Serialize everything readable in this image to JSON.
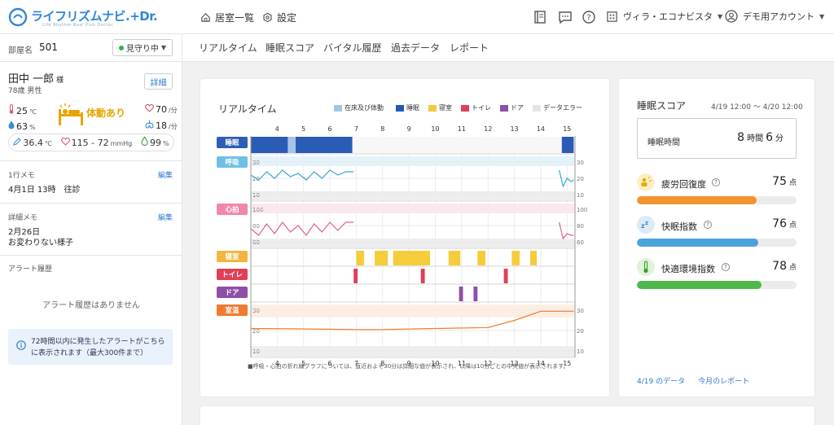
{
  "header": {
    "app_name": "ライフリズムナビ.+Dr.",
    "app_sub": "Life Rhythm Navi Plus Doctor",
    "nav_rooms": "居室一覧",
    "nav_settings": "設定",
    "facility": "ヴィラ・エコナビスタ",
    "account": "デモ用アカウント"
  },
  "sidebar": {
    "room_label": "部屋名",
    "room_no": "501",
    "watch_status": "見守り中",
    "resident_name": "田中 一郎",
    "honorific": "様",
    "age_gender": "78歳 男性",
    "detail_btn": "詳細",
    "temp_room": "25",
    "temp_unit": "℃",
    "humidity": "63",
    "humidity_unit": "%",
    "movement": "体動あり",
    "heart": "70",
    "heart_unit": "/分",
    "resp": "18",
    "resp_unit": "/分",
    "body_temp": "36.4",
    "body_temp_unit": "℃",
    "bp": "115 - 72",
    "bp_unit": "mmHg",
    "spo2": "99",
    "spo2_unit": "%",
    "memo1_label": "1行メモ",
    "memo1_edit": "編集",
    "memo1_body": "4月1日 13時　往診",
    "memo2_label": "詳細メモ",
    "memo2_edit": "編集",
    "memo2_date": "2月26日",
    "memo2_body": "お変わりない様子",
    "alert_label": "アラート履歴",
    "alert_empty": "アラート履歴はありません",
    "alert_info_1": "72時間以内に発生したアラートがこちら",
    "alert_info_2": "に表示されます（最大300件まで）"
  },
  "tabs": [
    "リアルタイム",
    "睡眠スコア",
    "バイタル履歴",
    "過去データ",
    "レポート"
  ],
  "realtime": {
    "title": "リアルタイム",
    "legend": [
      {
        "label": "在床及び体動",
        "color": "#a6c5e6"
      },
      {
        "label": "睡眠",
        "color": "#1f5bb5"
      },
      {
        "label": "寝室",
        "color": "#f5c842"
      },
      {
        "label": "トイレ",
        "color": "#e04057"
      },
      {
        "label": "ドア",
        "color": "#8e4fa8"
      },
      {
        "label": "データエラー",
        "color": "#e5e5e5"
      }
    ],
    "note": "■呼吸・心拍の折れ線グラフについては、直近およそ30分は詳細な値が表示され、以降は10分ごとの中央値が表示されます。"
  },
  "chart_data": {
    "type": "line",
    "x_ticks": [
      "4",
      "5",
      "6",
      "7",
      "8",
      "9",
      "10",
      "11",
      "12",
      "13",
      "14",
      "15"
    ],
    "rows": [
      {
        "label": "睡眠",
        "color": "#2b5fb5"
      },
      {
        "label": "呼吸",
        "color": "#4fa9d6",
        "y_ticks": [
          "30",
          "20",
          "10"
        ]
      },
      {
        "label": "心拍",
        "color": "#e57ba3",
        "y_ticks": [
          "100",
          "80",
          "60"
        ]
      },
      {
        "label": "寝室",
        "color": "#f0a530"
      },
      {
        "label": "トイレ",
        "color": "#e04057"
      },
      {
        "label": "ドア",
        "color": "#8e4fa8"
      },
      {
        "label": "室温",
        "color": "#f07a2f",
        "y_ticks": [
          "30",
          "20",
          "10"
        ]
      }
    ],
    "sleep_blocks": [
      [
        3.0,
        6.85,
        "sleep"
      ],
      [
        4.4,
        4.7,
        "bed"
      ],
      [
        14.8,
        15.25,
        "sleep"
      ]
    ],
    "bedroom_blocks": [
      [
        7.0,
        7.3
      ],
      [
        7.7,
        8.2
      ],
      [
        8.4,
        9.8
      ],
      [
        10.5,
        10.95
      ],
      [
        11.6,
        11.9
      ],
      [
        12.9,
        13.2
      ],
      [
        13.6,
        13.85
      ]
    ],
    "toilet_blocks": [
      [
        6.9,
        7.05
      ],
      [
        9.45,
        9.6
      ],
      [
        12.6,
        12.75
      ]
    ],
    "door_blocks": [
      [
        10.9,
        11.05
      ],
      [
        11.45,
        11.6
      ]
    ],
    "resp_values": [
      [
        3.0,
        22
      ],
      [
        3.3,
        19
      ],
      [
        3.6,
        24
      ],
      [
        3.9,
        20
      ],
      [
        4.2,
        25
      ],
      [
        4.5,
        21
      ],
      [
        4.8,
        23
      ],
      [
        5.1,
        19
      ],
      [
        5.4,
        24
      ],
      [
        5.7,
        20
      ],
      [
        6.0,
        25
      ],
      [
        6.3,
        22
      ],
      [
        6.6,
        24
      ],
      [
        6.9,
        24
      ]
    ],
    "resp_recent": [
      [
        14.7,
        25
      ],
      [
        14.85,
        15
      ],
      [
        15.0,
        20
      ],
      [
        15.15,
        18
      ],
      [
        15.25,
        19
      ]
    ],
    "heart_values": [
      [
        3.0,
        76
      ],
      [
        3.3,
        68
      ],
      [
        3.6,
        82
      ],
      [
        3.9,
        70
      ],
      [
        4.2,
        84
      ],
      [
        4.5,
        72
      ],
      [
        4.8,
        80
      ],
      [
        5.1,
        68
      ],
      [
        5.4,
        82
      ],
      [
        5.7,
        72
      ],
      [
        6.0,
        84
      ],
      [
        6.3,
        74
      ],
      [
        6.6,
        84
      ],
      [
        6.9,
        84
      ]
    ],
    "heart_recent": [
      [
        14.7,
        84
      ],
      [
        14.85,
        64
      ],
      [
        15.0,
        70
      ],
      [
        15.15,
        68
      ],
      [
        15.25,
        68
      ]
    ],
    "room_temp": [
      [
        3.0,
        21
      ],
      [
        5.0,
        20.8
      ],
      [
        7.0,
        20.5
      ],
      [
        8.0,
        20.5
      ],
      [
        10.0,
        21
      ],
      [
        12.0,
        21.5
      ],
      [
        13.0,
        25
      ],
      [
        14.0,
        29.5
      ],
      [
        15.25,
        29.5
      ]
    ]
  },
  "sleep_score": {
    "title": "睡眠スコア",
    "range": "4/19 12:00 〜 4/20 12:00",
    "sleep_time_label": "睡眠時間",
    "hours": "8",
    "hours_unit": "時間",
    "minutes": "6",
    "minutes_unit": "分",
    "items": [
      {
        "name": "疲労回復度",
        "value": "75",
        "unit": "点",
        "percent": 75,
        "color": "#f3932d",
        "icon_bg": "#fdf0c5",
        "icon_color": "#e7a80b"
      },
      {
        "name": "快眠指数",
        "value": "76",
        "unit": "点",
        "percent": 76,
        "color": "#4ca2dc",
        "icon_bg": "#dcecf7",
        "icon_color": "#3e8ac7"
      },
      {
        "name": "快適環境指数",
        "value": "78",
        "unit": "点",
        "percent": 78,
        "color": "#4fb84b",
        "icon_bg": "#e2f2da",
        "icon_color": "#3d9a3a"
      }
    ],
    "link_today": "4/19 のデータ",
    "link_month": "今月のレポート"
  }
}
